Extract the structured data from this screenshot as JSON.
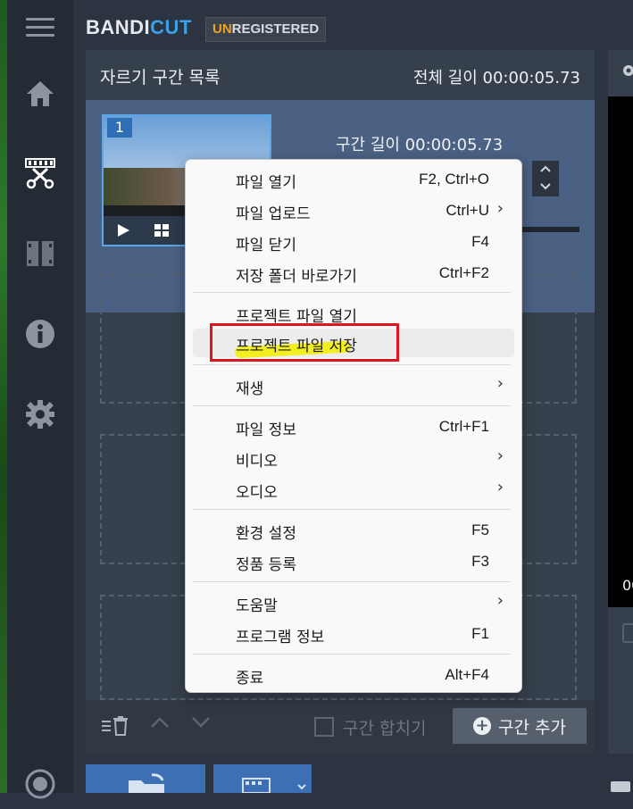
{
  "app": {
    "logo_main": "BANDI",
    "logo_accent": "CUT",
    "registration_prefix": "UN",
    "registration_rest": "REGISTERED"
  },
  "sidebar": {
    "items": [
      {
        "icon": "menu-icon"
      },
      {
        "icon": "home-icon"
      },
      {
        "icon": "cut-icon"
      },
      {
        "icon": "join-icon"
      },
      {
        "icon": "info-icon"
      },
      {
        "icon": "settings-icon"
      },
      {
        "icon": "record-icon"
      }
    ]
  },
  "segments_panel": {
    "title": "자르기 구간 목록",
    "total_length_label": "전체 길이 00:00:05.73",
    "segments": [
      {
        "number": "1",
        "length_label": "구간 길이 00:00:05.73"
      }
    ],
    "footer": {
      "merge_label": "구간 합치기",
      "add_label": "구간 추가"
    }
  },
  "context_menu": {
    "groups": [
      [
        {
          "label": "파일 열기",
          "shortcut": "F2, Ctrl+O"
        },
        {
          "label": "파일 업로드",
          "shortcut": "Ctrl+U",
          "submenu": true
        },
        {
          "label": "파일 닫기",
          "shortcut": "F4"
        },
        {
          "label": "저장 폴더 바로가기",
          "shortcut": "Ctrl+F2"
        }
      ],
      [
        {
          "label": "프로젝트 파일 열기",
          "shortcut": ""
        },
        {
          "label": "프로젝트 파일 저장",
          "shortcut": "",
          "highlighted": true
        }
      ],
      [
        {
          "label": "재생",
          "shortcut": "",
          "submenu": true
        }
      ],
      [
        {
          "label": "파일 정보",
          "shortcut": "Ctrl+F1"
        },
        {
          "label": "비디오",
          "shortcut": "",
          "submenu": true
        },
        {
          "label": "오디오",
          "shortcut": "",
          "submenu": true
        }
      ],
      [
        {
          "label": "환경 설정",
          "shortcut": "F5"
        },
        {
          "label": "정품 등록",
          "shortcut": "F3"
        }
      ],
      [
        {
          "label": "도움말",
          "shortcut": "",
          "submenu": true
        },
        {
          "label": "프로그램 정보",
          "shortcut": "F1"
        }
      ],
      [
        {
          "label": "종료",
          "shortcut": "Alt+F4"
        }
      ]
    ]
  },
  "preview": {
    "time_fragment": "00"
  },
  "colors": {
    "accent": "#3aa0e8",
    "unregistered": "#f0a21c",
    "annotation_box": "#e0141e",
    "annotation_highlight": "#f2ee14"
  }
}
